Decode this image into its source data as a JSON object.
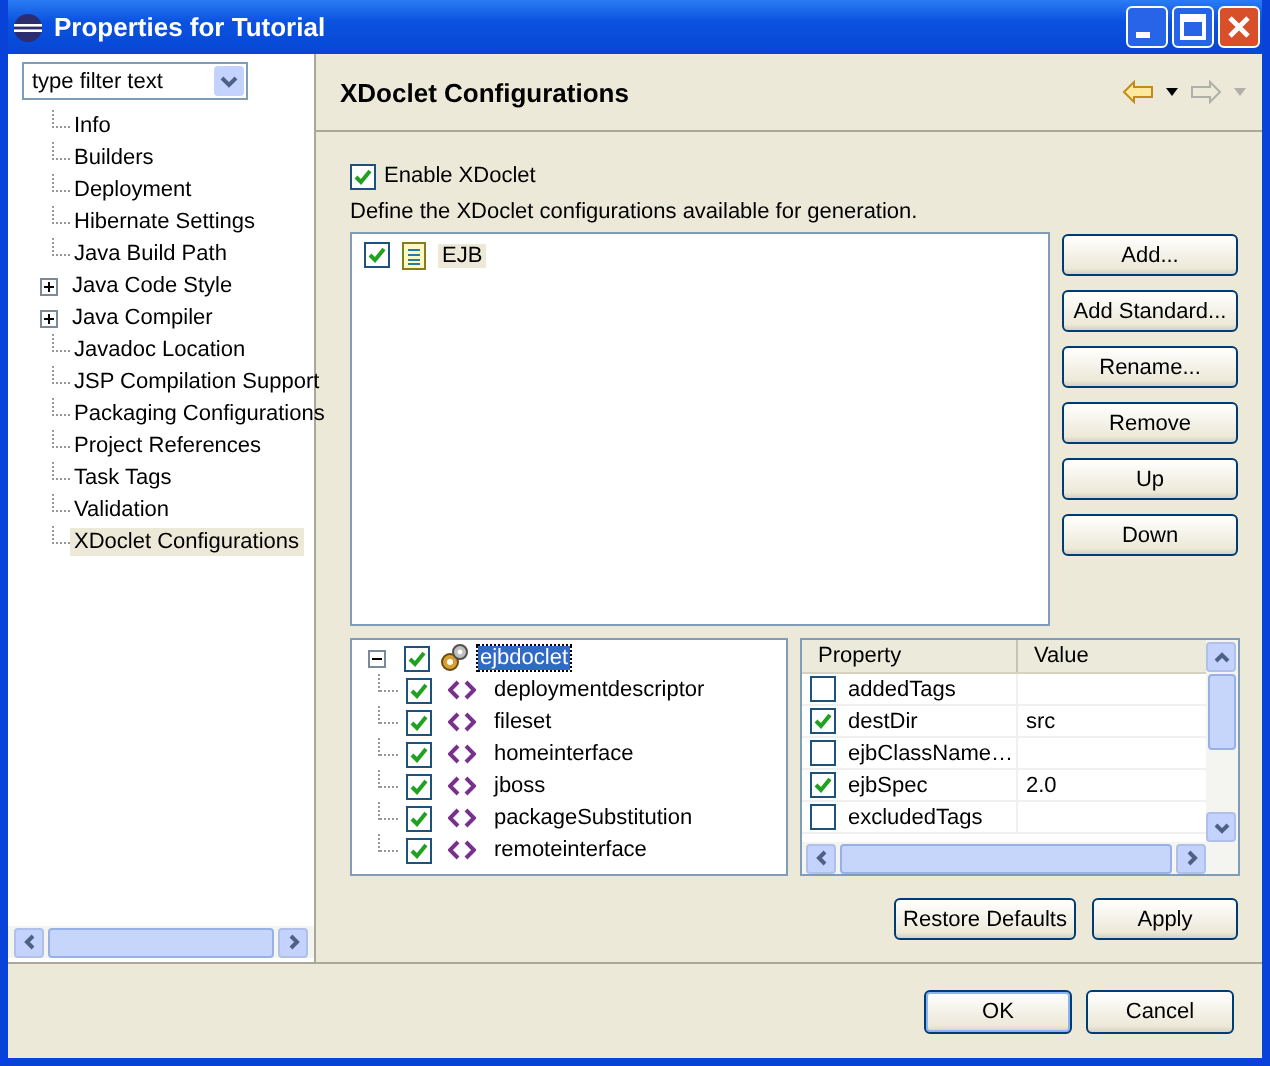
{
  "window": {
    "title": "Properties for Tutorial"
  },
  "filter": {
    "value": "type filter text"
  },
  "sidebar": {
    "items": [
      {
        "label": "Info",
        "kind": "leaf",
        "selected": false
      },
      {
        "label": "Builders",
        "kind": "leaf",
        "selected": false
      },
      {
        "label": "Deployment",
        "kind": "leaf",
        "selected": false
      },
      {
        "label": "Hibernate Settings",
        "kind": "leaf",
        "selected": false
      },
      {
        "label": "Java Build Path",
        "kind": "leaf",
        "selected": false
      },
      {
        "label": "Java Code Style",
        "kind": "group",
        "expanded": false,
        "selected": false
      },
      {
        "label": "Java Compiler",
        "kind": "group",
        "expanded": false,
        "selected": false
      },
      {
        "label": "Javadoc Location",
        "kind": "leaf",
        "selected": false
      },
      {
        "label": "JSP Compilation Support",
        "kind": "leaf",
        "selected": false
      },
      {
        "label": "Packaging Configurations",
        "kind": "leaf",
        "selected": false
      },
      {
        "label": "Project References",
        "kind": "leaf",
        "selected": false
      },
      {
        "label": "Task Tags",
        "kind": "leaf",
        "selected": false
      },
      {
        "label": "Validation",
        "kind": "leaf",
        "selected": false
      },
      {
        "label": "XDoclet Configurations",
        "kind": "leaf",
        "selected": true
      }
    ]
  },
  "page": {
    "title": "XDoclet Configurations",
    "back_enabled": true,
    "forward_enabled": false
  },
  "enable_xdoclet": {
    "label": "Enable XDoclet",
    "checked": true
  },
  "description": "Define the XDoclet configurations available for generation.",
  "configurations": [
    {
      "label": "EJB",
      "checked": true,
      "selected": true
    }
  ],
  "config_buttons": [
    "Add...",
    "Add Standard...",
    "Rename...",
    "Remove",
    "Up",
    "Down"
  ],
  "tree": {
    "label": "ejbdoclet",
    "checked": true,
    "selected": true,
    "expanded": true,
    "children": [
      {
        "label": "deploymentdescriptor",
        "checked": true
      },
      {
        "label": "fileset",
        "checked": true
      },
      {
        "label": "homeinterface",
        "checked": true
      },
      {
        "label": "jboss",
        "checked": true
      },
      {
        "label": "packageSubstitution",
        "checked": true
      },
      {
        "label": "remoteinterface",
        "checked": true
      }
    ]
  },
  "properties": {
    "columns": [
      "Property",
      "Value"
    ],
    "rows": [
      {
        "name": "addedTags",
        "checked": false,
        "value": ""
      },
      {
        "name": "destDir",
        "checked": true,
        "value": "src"
      },
      {
        "name": "ejbClassName…",
        "checked": false,
        "value": ""
      },
      {
        "name": "ejbSpec",
        "checked": true,
        "value": "2.0"
      },
      {
        "name": "excludedTags",
        "checked": false,
        "value": ""
      }
    ]
  },
  "page_buttons": [
    "Restore Defaults",
    "Apply"
  ],
  "dialog_buttons": [
    "OK",
    "Cancel"
  ]
}
